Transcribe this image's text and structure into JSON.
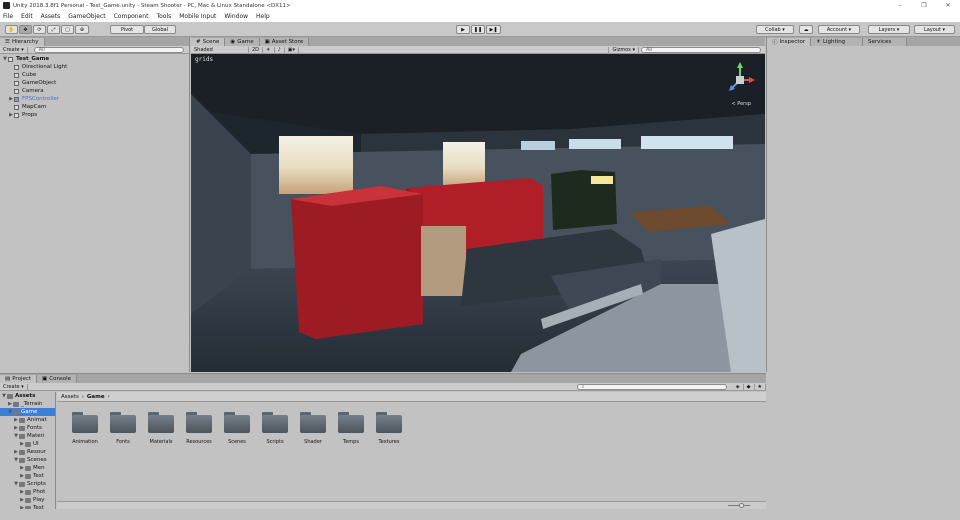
{
  "window": {
    "title": "Unity 2018.3.8f1 Personal - Test_Game.unity - Steam Shooter - PC, Mac & Linux Standalone <DX11>",
    "controls": [
      "–",
      "❐",
      "✕"
    ]
  },
  "menu": [
    "File",
    "Edit",
    "Assets",
    "GameObject",
    "Component",
    "Tools",
    "Mobile Input",
    "Window",
    "Help"
  ],
  "toolbar": {
    "pivot": "Pivot",
    "global": "Global",
    "collab": "Collab ▾",
    "account": "Account",
    "layers": "Layers",
    "layout": "Layout"
  },
  "hierarchy": {
    "tab": "Hierarchy",
    "create": "Create ▾",
    "search_placeholder": "All",
    "scene": "Test_Game",
    "items": [
      {
        "label": "Directional Light",
        "indent": 1,
        "expandable": false,
        "prefab": false
      },
      {
        "label": "Cube",
        "indent": 1,
        "expandable": false,
        "prefab": false
      },
      {
        "label": "GameObject",
        "indent": 1,
        "expandable": false,
        "prefab": false
      },
      {
        "label": "Camera",
        "indent": 1,
        "expandable": false,
        "prefab": false
      },
      {
        "label": "FPSController",
        "indent": 1,
        "expandable": true,
        "prefab": true
      },
      {
        "label": "MapCam",
        "indent": 1,
        "expandable": false,
        "prefab": false
      },
      {
        "label": "Props",
        "indent": 1,
        "expandable": true,
        "prefab": false
      }
    ]
  },
  "scene_view": {
    "tabs": [
      "Scene",
      "Game",
      "Asset Store"
    ],
    "shading": "Shaded",
    "mode_2d": "2D",
    "gizmos": "Gizmos ▾",
    "search_placeholder": "All",
    "overlay_text": "grids",
    "persp_label": "< Persp"
  },
  "inspector": {
    "tabs": [
      "Inspector",
      "Lighting",
      "Services"
    ]
  },
  "project": {
    "tabs": [
      "Project",
      "Console"
    ],
    "create": "Create ▾",
    "breadcrumb": [
      "Assets",
      "Game"
    ],
    "tree": [
      {
        "label": "Assets",
        "indent": 0,
        "expanded": true,
        "bold": true
      },
      {
        "label": "_Terrain",
        "indent": 1,
        "expanded": false,
        "bold": false
      },
      {
        "label": "Game",
        "indent": 1,
        "expanded": true,
        "bold": false,
        "selected": true
      },
      {
        "label": "Animat",
        "indent": 2,
        "expanded": false,
        "bold": false
      },
      {
        "label": "Fonts",
        "indent": 2,
        "expanded": false,
        "bold": false
      },
      {
        "label": "Materi",
        "indent": 2,
        "expanded": true,
        "bold": false
      },
      {
        "label": "UI",
        "indent": 3,
        "expanded": false,
        "bold": false
      },
      {
        "label": "Resour",
        "indent": 2,
        "expanded": false,
        "bold": false
      },
      {
        "label": "Scenes",
        "indent": 2,
        "expanded": true,
        "bold": false
      },
      {
        "label": "Men",
        "indent": 3,
        "expanded": false,
        "bold": false
      },
      {
        "label": "Test",
        "indent": 3,
        "expanded": false,
        "bold": false
      },
      {
        "label": "Scripts",
        "indent": 2,
        "expanded": true,
        "bold": false
      },
      {
        "label": "Phot",
        "indent": 3,
        "expanded": false,
        "bold": false
      },
      {
        "label": "Play",
        "indent": 3,
        "expanded": false,
        "bold": false
      },
      {
        "label": "Test",
        "indent": 3,
        "expanded": false,
        "bold": false
      }
    ],
    "folders": [
      "Animation",
      "Fonts",
      "Materials",
      "Resources",
      "Scenes",
      "Scripts",
      "Shader",
      "Temps",
      "Textures"
    ]
  },
  "colors": {
    "chrome": "#c2c2c2",
    "tab_bar": "#a5a5a5",
    "selection": "#3d7fd6",
    "prefab_text": "#4a6fc4"
  }
}
